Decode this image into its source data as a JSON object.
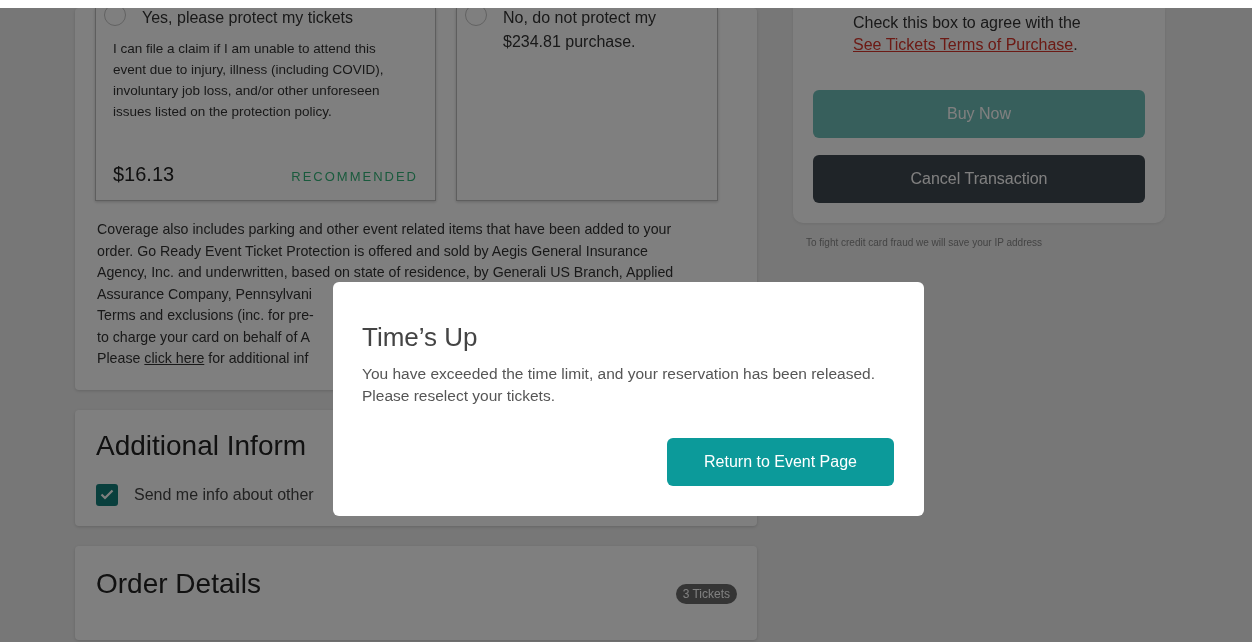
{
  "protection": {
    "options": [
      {
        "title": "Yes, please protect my tickets",
        "description_lines": [
          "I can file a claim if I am unable to attend this",
          "event due to injury, illness (including COVID),",
          "involuntary job loss, and/or other unforeseen",
          "issues listed on the protection policy."
        ],
        "price": "$16.13",
        "badge": "RECOMMENDED",
        "selected": false
      },
      {
        "title": "No, do not protect my $234.81 purchase.",
        "selected": false
      }
    ],
    "coverage_lines": [
      "Coverage also includes parking and other event related items that have been added to your",
      "order. Go Ready Event Ticket Protection is offered and sold by Aegis General Insurance",
      "Agency, Inc. and underwritten, based on state of residence, by Generali US Branch, Applied",
      "Assurance Company, Pennsylvani",
      "Terms and exclusions (inc. for pre-",
      "to charge your card on behalf of A"
    ],
    "coverage_last": {
      "before": "Please",
      "link": "click here",
      "after": "for additional inf"
    }
  },
  "additional_info": {
    "title": "Additional Inform",
    "checkbox": {
      "label": "Send me info about other",
      "checked": true
    }
  },
  "order_details": {
    "title": "Order Details",
    "badge": "3 Tickets"
  },
  "checkout": {
    "agree_text": "Check this box to agree with the",
    "agree_link": "See Tickets Terms of Purchase",
    "agree_end": ".",
    "buy_button": {
      "label": "Buy Now",
      "disabled": true
    },
    "cancel_button": "Cancel Transaction",
    "fraud_note": "To fight credit card fraud we will save your IP address"
  },
  "modal": {
    "title": "Time’s Up",
    "message": "You have exceeded the time limit, and your reservation has been released. Please reselect your tickets.",
    "button": "Return to Event Page"
  }
}
